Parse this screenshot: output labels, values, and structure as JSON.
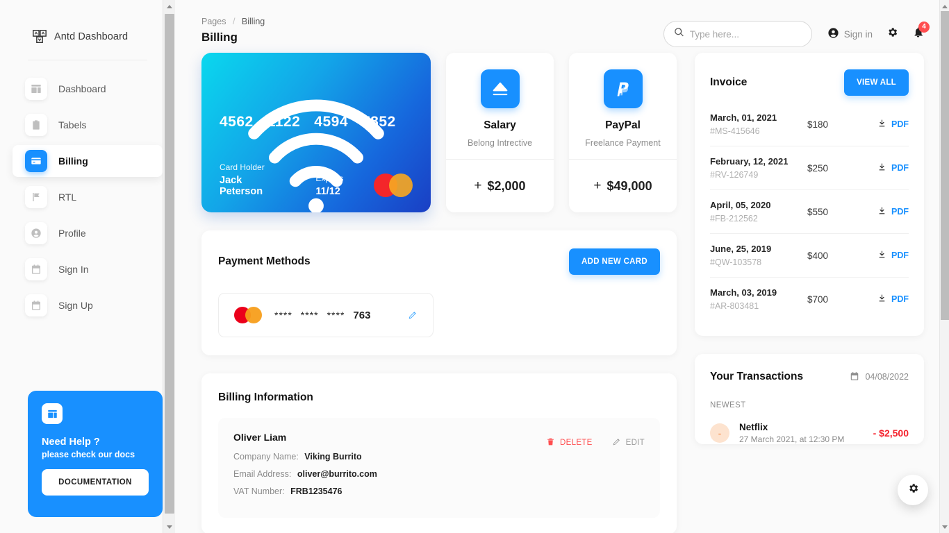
{
  "sidebar": {
    "brand": "Antd Dashboard",
    "items": [
      {
        "label": "Dashboard",
        "icon": "dashboard-icon",
        "active": false
      },
      {
        "label": "Tabels",
        "icon": "clipboard-icon",
        "active": false
      },
      {
        "label": "Billing",
        "icon": "credit-card-icon",
        "active": true
      },
      {
        "label": "RTL",
        "icon": "flag-icon",
        "active": false
      },
      {
        "label": "Profile",
        "icon": "user-circle-icon",
        "active": false
      },
      {
        "label": "Sign In",
        "icon": "calendar-icon",
        "active": false
      },
      {
        "label": "Sign Up",
        "icon": "calendar-icon",
        "active": false
      }
    ],
    "help": {
      "title": "Need Help ?",
      "subtitle": "please check our docs",
      "button": "DOCUMENTATION"
    }
  },
  "header": {
    "breadcrumb_root": "Pages",
    "breadcrumb_sep": "/",
    "breadcrumb_current": "Billing",
    "page_title": "Billing",
    "search_placeholder": "Type here...",
    "search_value": "",
    "signin_label": "Sign in",
    "notification_count": "4"
  },
  "credit_card": {
    "number_groups": [
      "4562",
      "1122",
      "4594",
      "7852"
    ],
    "holder_label": "Card Holder",
    "holder_value": "Jack Peterson",
    "expires_label": "Expires",
    "expires_value": "11/12"
  },
  "mini_cards": [
    {
      "title": "Salary",
      "subtitle": "Belong Intrective",
      "plus": "+",
      "amount": "$2,000",
      "icon": "eject-icon"
    },
    {
      "title": "PayPal",
      "subtitle": "Freelance Payment",
      "plus": "+",
      "amount": "$49,000",
      "icon": "paypal-icon"
    }
  ],
  "payment_methods": {
    "title": "Payment Methods",
    "add_button": "ADD NEW CARD",
    "cards": [
      {
        "brand": "mastercard",
        "masked": [
          "****",
          "****",
          "****"
        ],
        "last": "763"
      }
    ]
  },
  "billing_information": {
    "title": "Billing Information",
    "entries": [
      {
        "name": "Oliver Liam",
        "company_label": "Company Name:",
        "company_value": "Viking Burrito",
        "email_label": "Email Address:",
        "email_value": "oliver@burrito.com",
        "vat_label": "VAT Number:",
        "vat_value": "FRB1235476",
        "delete_label": "DELETE",
        "edit_label": "EDIT"
      }
    ]
  },
  "invoice": {
    "title": "Invoice",
    "view_all": "VIEW ALL",
    "pdf_label": "PDF",
    "rows": [
      {
        "date": "March, 01, 2021",
        "id": "#MS-415646",
        "amount": "$180"
      },
      {
        "date": "February, 12, 2021",
        "id": "#RV-126749",
        "amount": "$250"
      },
      {
        "date": "April, 05, 2020",
        "id": "#FB-212562",
        "amount": "$550"
      },
      {
        "date": "June, 25, 2019",
        "id": "#QW-103578",
        "amount": "$400"
      },
      {
        "date": "March, 03, 2019",
        "id": "#AR-803481",
        "amount": "$700"
      }
    ]
  },
  "transactions": {
    "title": "Your Transactions",
    "date": "04/08/2022",
    "section_label": "NEWEST",
    "rows": [
      {
        "sign": "-",
        "name": "Netflix",
        "time": "27 March 2021, at 12:30 PM",
        "amount": "- $2,500"
      }
    ]
  },
  "colors": {
    "accent": "#1890ff",
    "danger": "#ff4d4f",
    "card_gradient_start": "#0ad8ee",
    "card_gradient_end": "#1a3fc4"
  }
}
